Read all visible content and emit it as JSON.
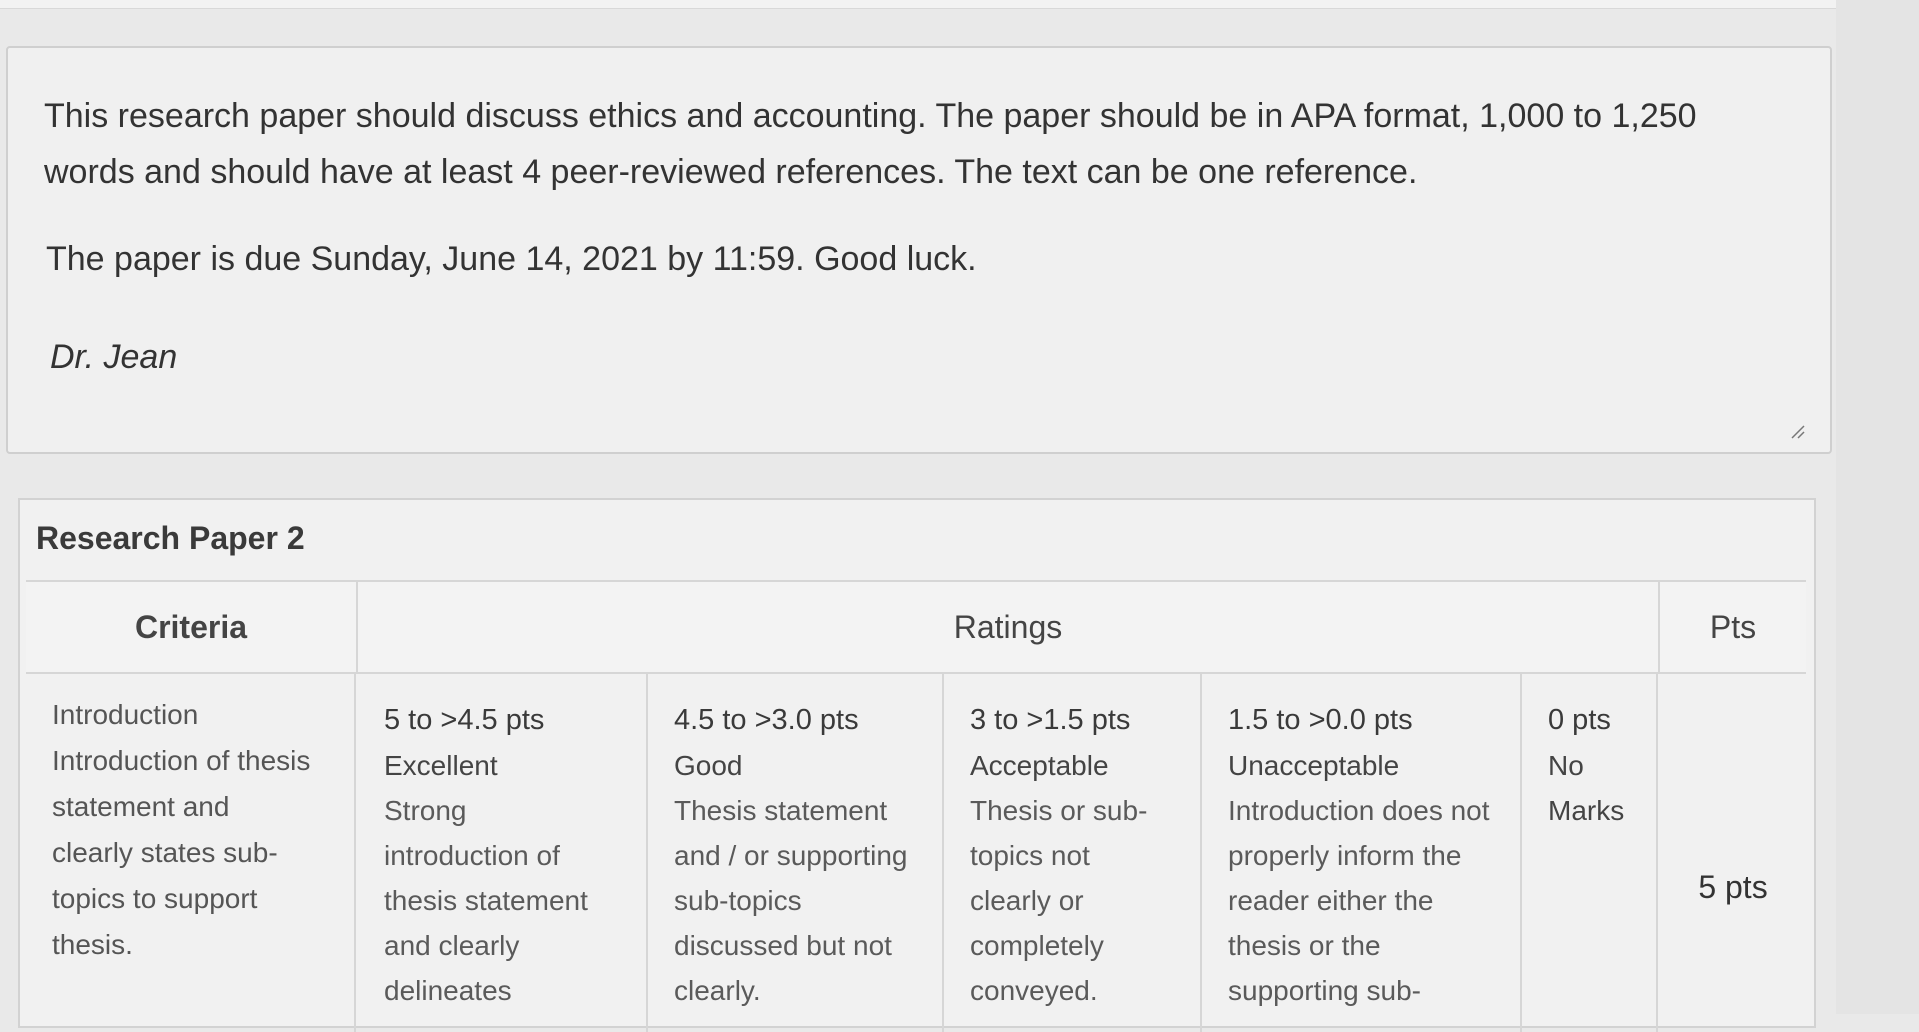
{
  "description": {
    "paragraph": "This research paper should discuss ethics and accounting. The paper should be in APA format, 1,000 to 1,250 words and should have at least 4 peer-reviewed references. The text can be one reference.",
    "due": "The paper is due Sunday, June 14, 2021 by 11:59. Good luck.",
    "signature": "Dr. Jean"
  },
  "rubric": {
    "title": "Research Paper 2",
    "headers": {
      "criteria": "Criteria",
      "ratings": "Ratings",
      "pts": "Pts"
    },
    "rows": [
      {
        "criterion_title": "Introduction",
        "criterion_desc": "Introduction of thesis statement and clearly states sub-topics to support thesis.",
        "ratings": [
          {
            "pts": "5 to >4.5 pts",
            "label": "Excellent",
            "desc": "Strong introduction of thesis statement and clearly delineates"
          },
          {
            "pts": "4.5 to >3.0 pts",
            "label": "Good",
            "desc": "Thesis statement and / or supporting sub-topics discussed but not clearly."
          },
          {
            "pts": "3 to >1.5 pts",
            "label": "Acceptable",
            "desc": "Thesis or sub-topics not clearly or completely conveyed."
          },
          {
            "pts": "1.5 to >0.0 pts",
            "label": "Unacceptable",
            "desc": "Introduction does not properly inform the reader either the thesis or the supporting sub-"
          },
          {
            "pts": "0 pts",
            "label": "No Marks",
            "desc": ""
          }
        ],
        "points": "5 pts"
      }
    ]
  }
}
